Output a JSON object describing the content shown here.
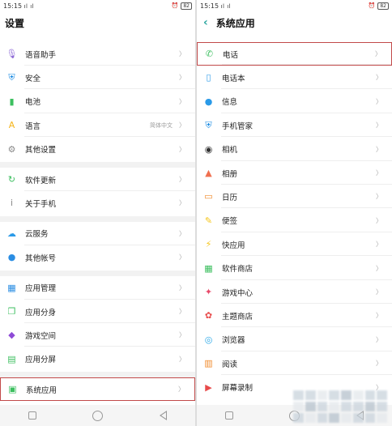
{
  "status": {
    "time": "15:15",
    "signal": "ᳩıl ᳩıl",
    "battery": "82"
  },
  "left_screen": {
    "title": "设置",
    "groups": [
      [
        {
          "label": "语音助手",
          "icon": "microphone-icon",
          "color": "#8e6ad6"
        },
        {
          "label": "安全",
          "icon": "shield-icon",
          "color": "#1e8de3"
        },
        {
          "label": "电池",
          "icon": "battery-icon",
          "color": "#3cbf5f"
        },
        {
          "label": "语言",
          "icon": "language-icon",
          "color": "#f5b418",
          "value": "简体中文"
        },
        {
          "label": "其他设置",
          "icon": "gear-icon",
          "color": "#8a8a8a"
        }
      ],
      [
        {
          "label": "软件更新",
          "icon": "update-icon",
          "color": "#3cbf5f"
        },
        {
          "label": "关于手机",
          "icon": "info-icon",
          "color": "#888888"
        }
      ],
      [
        {
          "label": "云服务",
          "icon": "cloud-icon",
          "color": "#2a9ae8"
        },
        {
          "label": "其他帐号",
          "icon": "user-icon",
          "color": "#2a8de3"
        }
      ],
      [
        {
          "label": "应用管理",
          "icon": "app-grid-icon",
          "color": "#2a8de3"
        },
        {
          "label": "应用分身",
          "icon": "clone-icon",
          "color": "#3cbf5f"
        },
        {
          "label": "游戏空间",
          "icon": "game-icon",
          "color": "#8e4ad6"
        },
        {
          "label": "应用分屏",
          "icon": "split-screen-icon",
          "color": "#3cbf5f"
        }
      ],
      [
        {
          "label": "系统应用",
          "icon": "system-apps-icon",
          "color": "#3cbf5f",
          "highlight": true
        }
      ]
    ]
  },
  "right_screen": {
    "title": "系统应用",
    "items": [
      {
        "label": "电话",
        "icon": "phone-icon",
        "color": "#3cbf5f",
        "highlight": true
      },
      {
        "label": "电话本",
        "icon": "contacts-icon",
        "color": "#2a9ae8"
      },
      {
        "label": "信息",
        "icon": "message-icon",
        "color": "#2a9ae8"
      },
      {
        "label": "手机管家",
        "icon": "shield-icon",
        "color": "#1e8de3"
      },
      {
        "label": "相机",
        "icon": "camera-icon",
        "color": "#333333"
      },
      {
        "label": "相册",
        "icon": "gallery-icon",
        "color": "#f07050"
      },
      {
        "label": "日历",
        "icon": "calendar-icon",
        "color": "#f08a2a"
      },
      {
        "label": "便签",
        "icon": "note-icon",
        "color": "#f5c518"
      },
      {
        "label": "快应用",
        "icon": "quick-app-icon",
        "color": "#f5c518"
      },
      {
        "label": "软件商店",
        "icon": "store-icon",
        "color": "#3cbf5f"
      },
      {
        "label": "游戏中心",
        "icon": "game-center-icon",
        "color": "#e84a6a"
      },
      {
        "label": "主题商店",
        "icon": "theme-store-icon",
        "color": "#e84a4a"
      },
      {
        "label": "浏览器",
        "icon": "browser-icon",
        "color": "#2aa8e8"
      },
      {
        "label": "阅读",
        "icon": "book-icon",
        "color": "#f08a2a"
      },
      {
        "label": "屏幕录制",
        "icon": "screen-record-icon",
        "color": "#e84a4a"
      }
    ]
  }
}
